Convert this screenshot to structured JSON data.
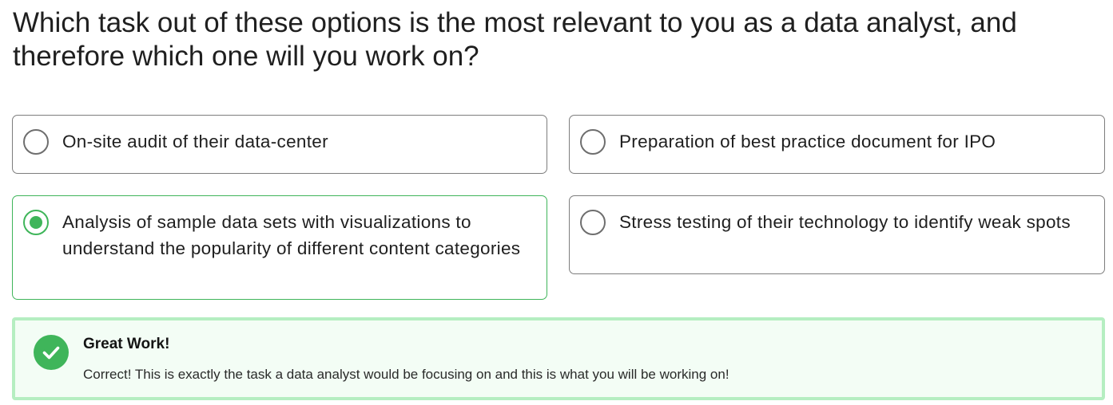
{
  "question": {
    "text": "Which task out of these options is the most relevant to you as a data analyst, and therefore which one will you work on?"
  },
  "options": [
    {
      "label": "On-site audit of their data-center",
      "selected": false
    },
    {
      "label": "Preparation of best practice document for IPO",
      "selected": false
    },
    {
      "label": "Analysis of sample data sets with visualizations to understand the popularity of different content categories",
      "selected": true
    },
    {
      "label": "Stress testing of their technology to identify weak spots",
      "selected": false
    }
  ],
  "feedback": {
    "icon": "check-circle-icon",
    "title": "Great Work!",
    "message": "Correct! This is exactly the task a data analyst would be focusing on and this is what you will be working on!"
  },
  "colors": {
    "accent_green": "#3fb55a",
    "feedback_border": "#b5eec1",
    "feedback_bg": "#f3fdf5",
    "option_border": "#7d7d7d"
  }
}
